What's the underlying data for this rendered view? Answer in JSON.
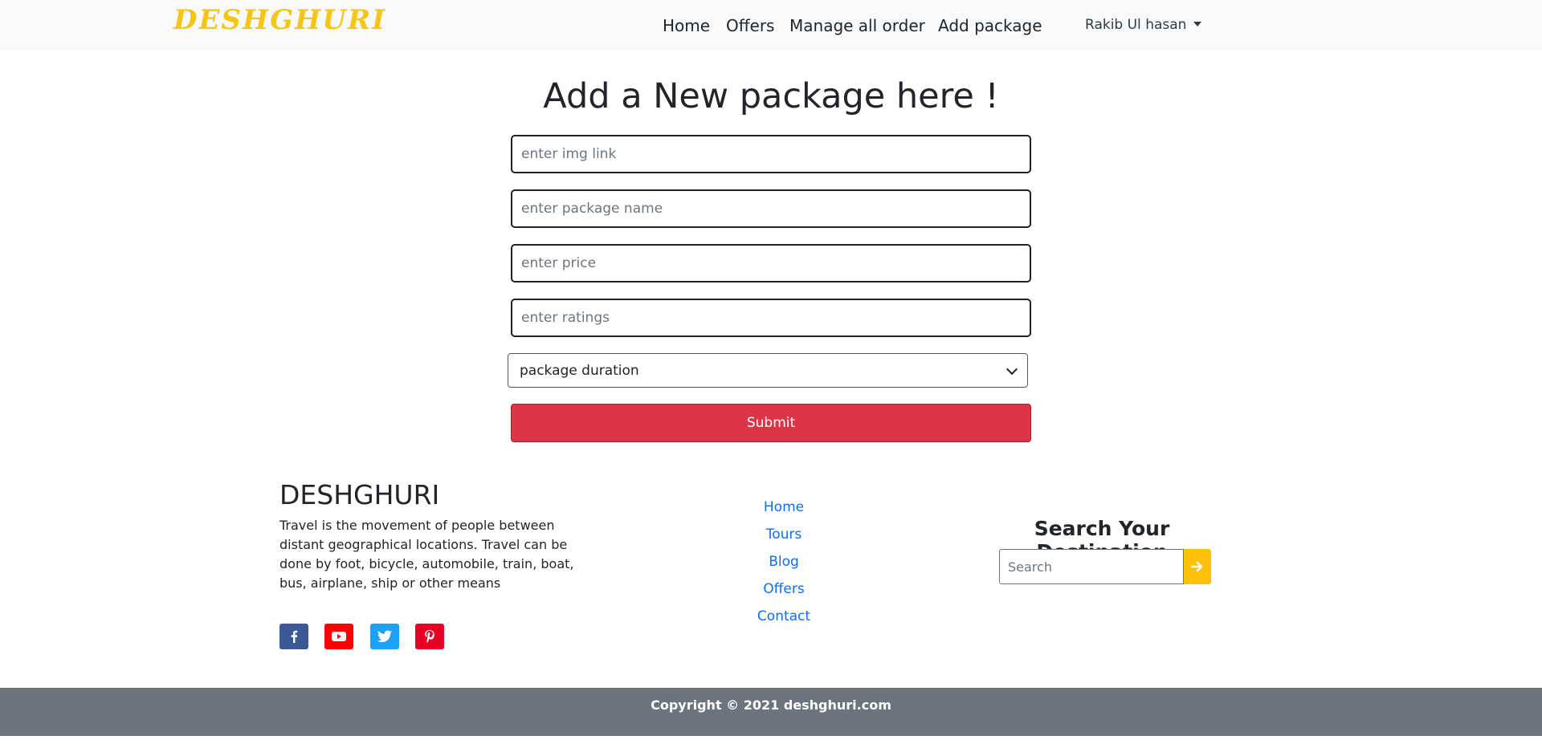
{
  "navbar": {
    "brand": "DESHGHURI",
    "links": [
      "Home",
      "Offers",
      "Manage all order",
      "Add package"
    ],
    "user_name": "Rakib Ul hasan"
  },
  "form": {
    "title": "Add a New package here !",
    "img_placeholder": "enter img link",
    "name_placeholder": "enter package name",
    "price_placeholder": "enter price",
    "ratings_placeholder": "enter ratings",
    "duration_selected": "package duration",
    "submit_label": "Submit"
  },
  "footer": {
    "brand": "DESHGHURI",
    "description": "Travel is the movement of people between distant geographical locations. Travel can be done by foot, bicycle, automobile, train, boat, bus, airplane, ship or other means",
    "social": [
      "facebook-icon",
      "youtube-icon",
      "twitter-icon",
      "pinterest-icon"
    ],
    "social_colors": [
      "#3b5998",
      "#ff0000",
      "#1da1f2",
      "#e60023"
    ],
    "links": [
      "Home",
      "Tours",
      "Blog",
      "Offers",
      "Contact"
    ],
    "search_title": "Search Your Destination",
    "search_placeholder": "Search",
    "copyright": "Copyright © 2021 deshghuri.com"
  },
  "colors": {
    "brand": "#f5c518",
    "submit": "#dc3545",
    "link": "#0d6efd",
    "search_button": "#ffc107",
    "footer_bar": "#6c757d"
  }
}
